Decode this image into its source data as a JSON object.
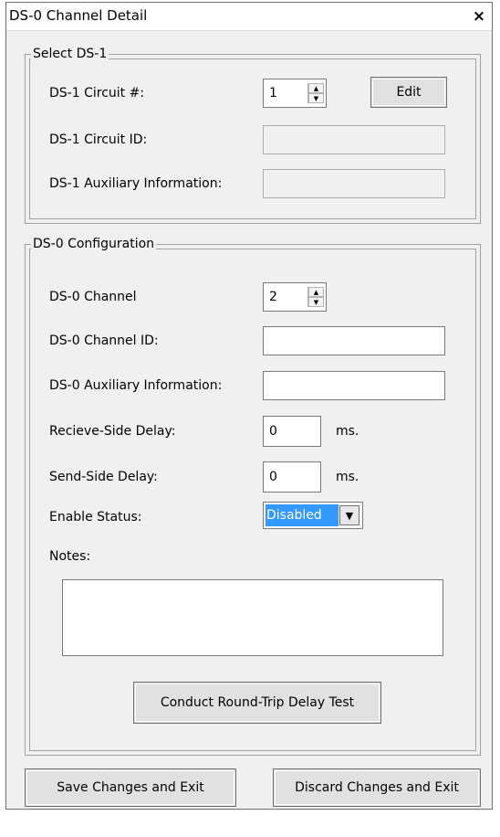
{
  "window": {
    "title": "DS-0 Channel Detail",
    "close_glyph": "×"
  },
  "ds1": {
    "legend": "Select DS-1",
    "circuit_label": "DS-1 Circuit #:",
    "circuit_value": "1",
    "edit_label": "Edit",
    "circuit_id_label": "DS-1 Circuit ID:",
    "circuit_id_value": "",
    "aux_label": "DS-1 Auxiliary Information:",
    "aux_value": ""
  },
  "ds0": {
    "legend": "DS-0 Configuration",
    "channel_label": "DS-0 Channel",
    "channel_value": "2",
    "channel_id_label": "DS-0 Channel ID:",
    "channel_id_value": "",
    "aux_label": "DS-0 Auxiliary Information:",
    "aux_value": "",
    "receive_delay_label": "Recieve-Side Delay:",
    "receive_delay_value": "0",
    "send_delay_label": "Send-Side Delay:",
    "send_delay_value": "0",
    "ms_unit": "ms.",
    "enable_status_label": "Enable Status:",
    "enable_status_value": "Disabled",
    "notes_label": "Notes:",
    "notes_value": "",
    "round_trip_button": "Conduct Round-Trip Delay Test"
  },
  "footer": {
    "save_label": "Save Changes and Exit",
    "discard_label": "Discard Changes and Exit"
  },
  "icons": {
    "spin_up": "▲",
    "spin_down": "▼",
    "dropdown_arrow": "▼"
  }
}
